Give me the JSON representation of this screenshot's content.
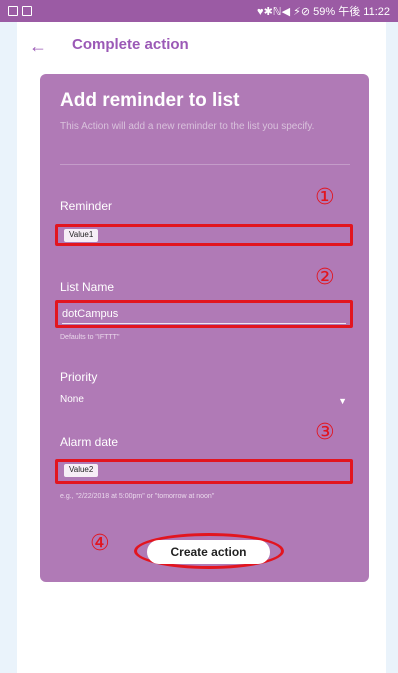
{
  "status_bar": {
    "time": "午後 11:22",
    "battery": "59%",
    "indicators": "♥✱ℕ◀ ⚡⊘"
  },
  "header": {
    "title": "Complete action",
    "back_icon": "arrow-left-icon"
  },
  "card": {
    "title": "Add reminder to list",
    "description": "This Action will add a new reminder to the list you specify.",
    "fields": {
      "reminder": {
        "label": "Reminder",
        "value": "Value1",
        "marker": "①"
      },
      "list_name": {
        "label": "List Name",
        "value": "dotCampus",
        "hint": "Defaults to \"IFTTT\"",
        "marker": "②"
      },
      "priority": {
        "label": "Priority",
        "value": "None"
      },
      "alarm_date": {
        "label": "Alarm date",
        "value": "Value2",
        "hint": "e.g., \"2/22/2018 at 5:00pm\" or \"tomorrow at noon\"",
        "marker": "③"
      }
    },
    "create_button": {
      "label": "Create action",
      "marker": "④"
    }
  },
  "colors": {
    "accent": "#9b59b6",
    "card": "#b07ab6",
    "highlight": "#e2151f"
  }
}
